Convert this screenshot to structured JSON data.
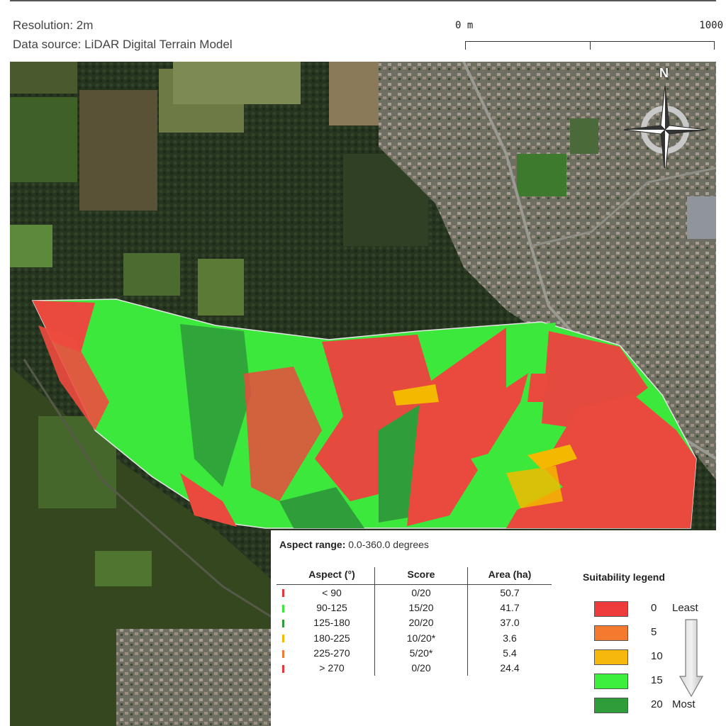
{
  "header": {
    "resolution": "Resolution: 2m",
    "data_source": "Data source: LiDAR Digital Terrain Model"
  },
  "scale_bar": {
    "start_label": "0 m",
    "end_label": "1000"
  },
  "north_arrow": {
    "label": "N",
    "icon": "compass-rose-icon"
  },
  "map": {
    "basemap": "aerial imagery",
    "overlay": "aspect suitability raster"
  },
  "aspect_range": {
    "label": "Aspect range:",
    "value": "0.0-360.0 degrees"
  },
  "table": {
    "headers": [
      "Aspect (°)",
      "Score",
      "Area (ha)"
    ],
    "rows": [
      {
        "aspect": "< 90",
        "score": "0/20",
        "area": "50.7",
        "color": "#e8363a"
      },
      {
        "aspect": "90-125",
        "score": "15/20",
        "area": "41.7",
        "color": "#3ce83c"
      },
      {
        "aspect": "125-180",
        "score": "20/20",
        "area": "37.0",
        "color": "#2f9e3a"
      },
      {
        "aspect": "180-225",
        "score": "10/20*",
        "area": "3.6",
        "color": "#f5b800"
      },
      {
        "aspect": "225-270",
        "score": "5/20*",
        "area": "5.4",
        "color": "#f47a30"
      },
      {
        "aspect": "> 270",
        "score": "0/20",
        "area": "24.4",
        "color": "#e8363a"
      }
    ]
  },
  "legend": {
    "title": "Suitability legend",
    "items": [
      {
        "value": "0",
        "color": "#ee3b3b"
      },
      {
        "value": "5",
        "color": "#f47a30"
      },
      {
        "value": "10",
        "color": "#f7b80e"
      },
      {
        "value": "15",
        "color": "#3def3d"
      },
      {
        "value": "20",
        "color": "#2f9e3a"
      }
    ],
    "least_label": "Least",
    "most_label": "Most"
  }
}
